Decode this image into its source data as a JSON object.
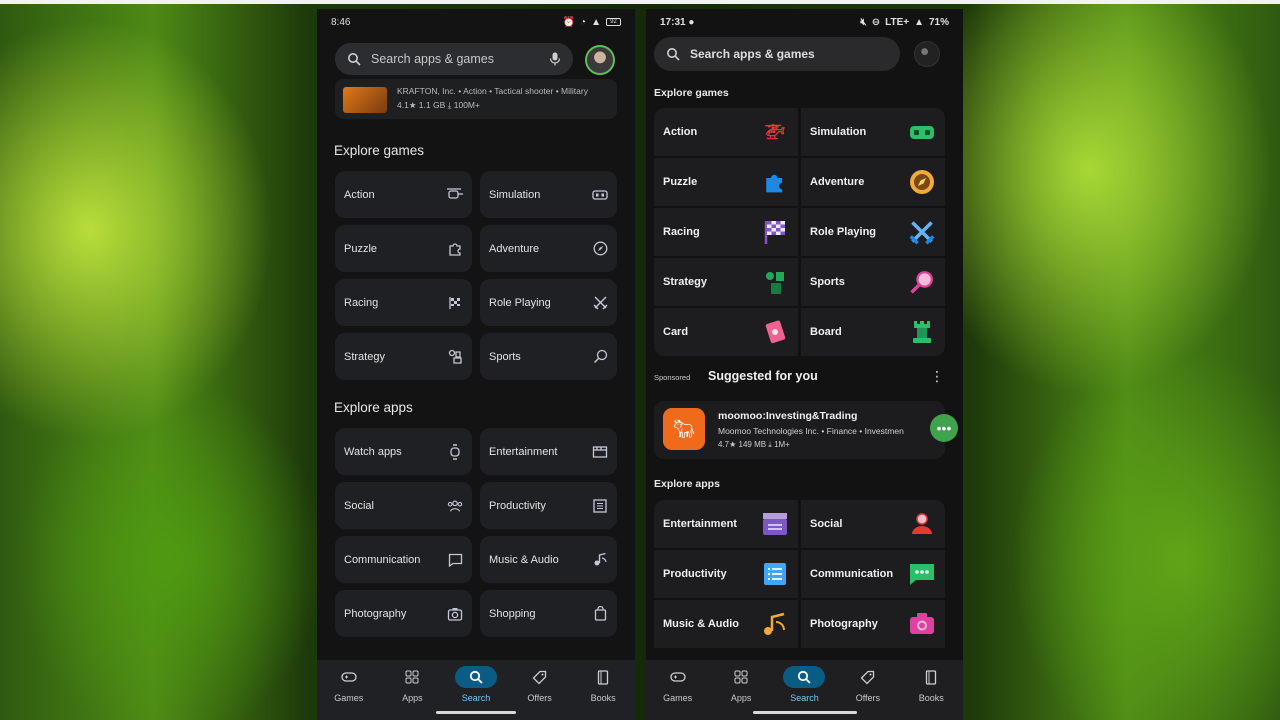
{
  "left": {
    "status": {
      "time": "8:46",
      "battery": "92"
    },
    "search_placeholder": "Search apps & games",
    "app_card": {
      "line1": "KRAFTON, Inc. • Action • Tactical shooter • Military",
      "line2": "4.1★ 1.1 GB ⤓ 100M+"
    },
    "games_title": "Explore games",
    "games": [
      "Action",
      "Simulation",
      "Puzzle",
      "Adventure",
      "Racing",
      "Role Playing",
      "Strategy",
      "Sports"
    ],
    "apps_title": "Explore apps",
    "apps": [
      "Watch apps",
      "Entertainment",
      "Social",
      "Productivity",
      "Communication",
      "Music & Audio",
      "Photography",
      "Shopping"
    ],
    "nav": [
      "Games",
      "Apps",
      "Search",
      "Offers",
      "Books"
    ]
  },
  "right": {
    "status": {
      "time": "17:31",
      "network": "LTE+",
      "battery": "71%"
    },
    "search_placeholder": "Search apps & games",
    "games_title": "Explore games",
    "games": [
      "Action",
      "Simulation",
      "Puzzle",
      "Adventure",
      "Racing",
      "Role Playing",
      "Strategy",
      "Sports",
      "Card",
      "Board"
    ],
    "sponsored": "Sponsored",
    "suggested_title": "Suggested for you",
    "suggested_app": {
      "title": "moomoo:Investing&Trading",
      "subtitle": "Moomoo Technologies Inc. • Finance • Investmen",
      "meta": "4.7★ 149 MB ⤓ 1M+"
    },
    "apps_title": "Explore apps",
    "apps": [
      "Entertainment",
      "Social",
      "Productivity",
      "Communication",
      "Music & Audio",
      "Photography"
    ],
    "nav": [
      "Games",
      "Apps",
      "Search",
      "Offers",
      "Books"
    ]
  },
  "colors": {
    "accent_nav": "#0b5c84",
    "fab": "#3fa34d"
  }
}
